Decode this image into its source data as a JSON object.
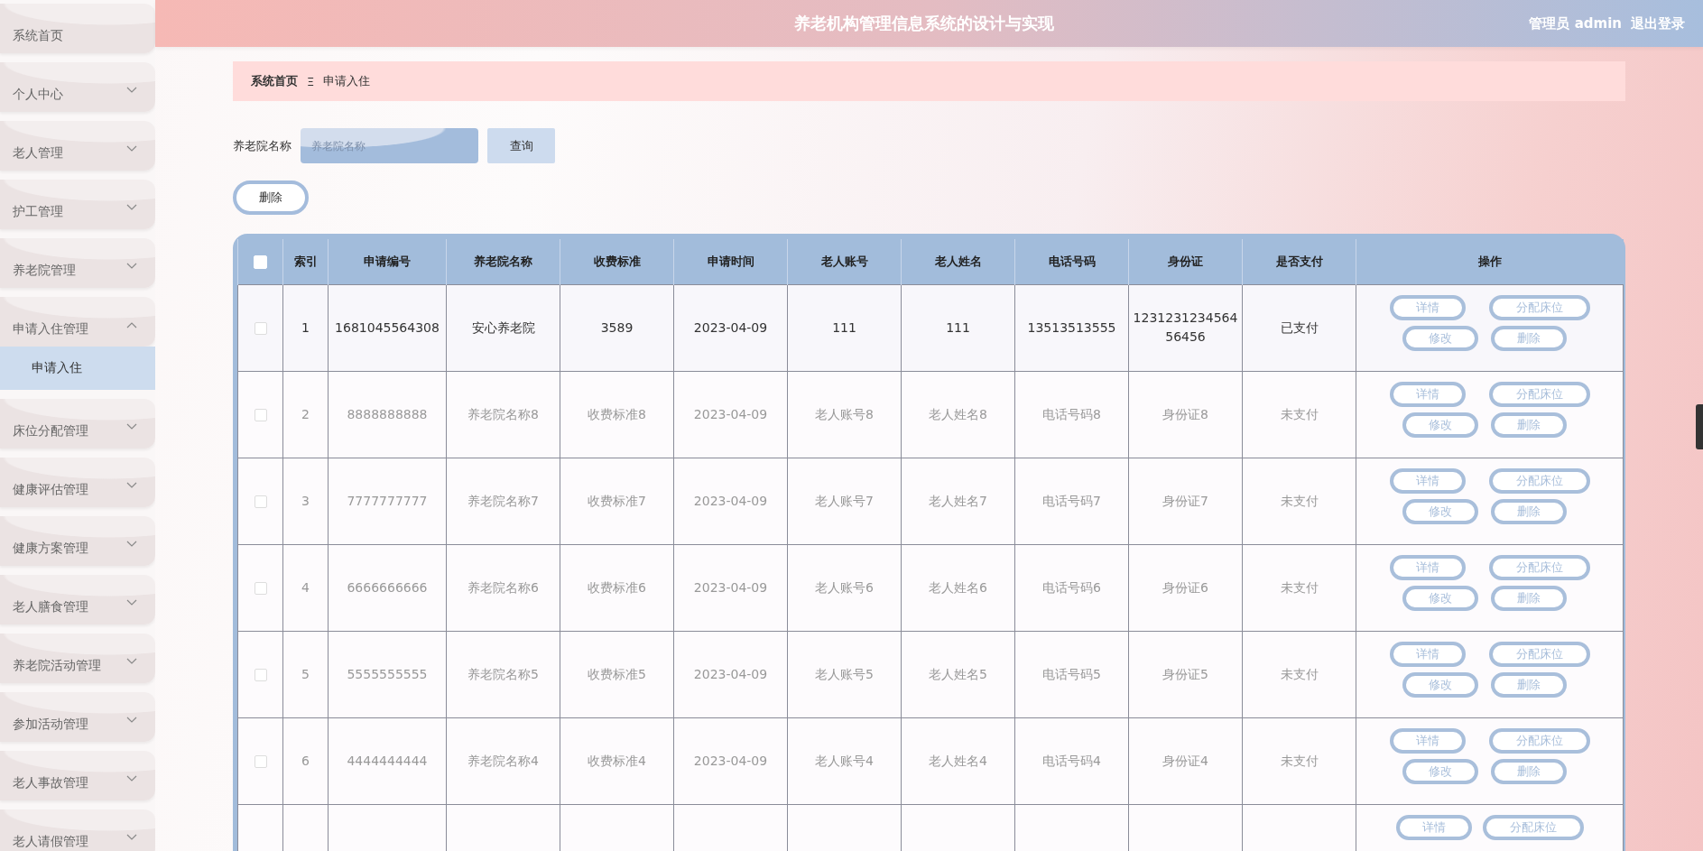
{
  "header": {
    "title": "养老机构管理信息系统的设计与实现",
    "user": "管理员 admin",
    "logout": "退出登录"
  },
  "sidebar": {
    "items": [
      {
        "label": "系统首页",
        "kind": "link"
      },
      {
        "label": "个人中心",
        "kind": "menu",
        "expanded": false
      },
      {
        "label": "老人管理",
        "kind": "menu",
        "expanded": false
      },
      {
        "label": "护工管理",
        "kind": "menu",
        "expanded": false
      },
      {
        "label": "养老院管理",
        "kind": "menu",
        "expanded": false
      },
      {
        "label": "申请入住管理",
        "kind": "menu",
        "expanded": true,
        "children": [
          {
            "label": "申请入住",
            "selected": true
          }
        ]
      },
      {
        "label": "床位分配管理",
        "kind": "menu",
        "expanded": false
      },
      {
        "label": "健康评估管理",
        "kind": "menu",
        "expanded": false
      },
      {
        "label": "健康方案管理",
        "kind": "menu",
        "expanded": false
      },
      {
        "label": "老人膳食管理",
        "kind": "menu",
        "expanded": false
      },
      {
        "label": "养老院活动管理",
        "kind": "menu",
        "expanded": false
      },
      {
        "label": "参加活动管理",
        "kind": "menu",
        "expanded": false
      },
      {
        "label": "老人事故管理",
        "kind": "menu",
        "expanded": false
      },
      {
        "label": "老人请假管理",
        "kind": "menu",
        "expanded": false
      }
    ]
  },
  "breadcrumb": {
    "items": [
      "系统首页",
      "申请入住"
    ],
    "separator": "Ξ"
  },
  "search": {
    "label": "养老院名称",
    "placeholder": "养老院名称",
    "button": "查询"
  },
  "delete_button": "删除",
  "table": {
    "all_checked": false,
    "columns": [
      "索引",
      "申请编号",
      "养老院名称",
      "收费标准",
      "申请时间",
      "老人账号",
      "老人姓名",
      "电话号码",
      "身份证",
      "是否支付",
      "操作"
    ],
    "rows": [
      {
        "highlighted": true,
        "checked": false,
        "cells": [
          "1",
          "1681045564308",
          "安心养老院",
          "3589",
          "2023-04-09",
          "111",
          "111",
          "13513513555",
          "1231231234564 56456",
          "已支付"
        ],
        "actions": [
          "详情",
          "分配床位",
          "修改",
          "删除"
        ]
      },
      {
        "highlighted": false,
        "checked": false,
        "cells": [
          "2",
          "8888888888",
          "养老院名称8",
          "收费标准8",
          "2023-04-09",
          "老人账号8",
          "老人姓名8",
          "电话号码8",
          "身份证8",
          "未支付"
        ],
        "actions": [
          "详情",
          "分配床位",
          "修改",
          "删除"
        ]
      },
      {
        "highlighted": false,
        "checked": false,
        "cells": [
          "3",
          "7777777777",
          "养老院名称7",
          "收费标准7",
          "2023-04-09",
          "老人账号7",
          "老人姓名7",
          "电话号码7",
          "身份证7",
          "未支付"
        ],
        "actions": [
          "详情",
          "分配床位",
          "修改",
          "删除"
        ]
      },
      {
        "highlighted": false,
        "checked": false,
        "cells": [
          "4",
          "6666666666",
          "养老院名称6",
          "收费标准6",
          "2023-04-09",
          "老人账号6",
          "老人姓名6",
          "电话号码6",
          "身份证6",
          "未支付"
        ],
        "actions": [
          "详情",
          "分配床位",
          "修改",
          "删除"
        ]
      },
      {
        "highlighted": false,
        "checked": false,
        "cells": [
          "5",
          "5555555555",
          "养老院名称5",
          "收费标准5",
          "2023-04-09",
          "老人账号5",
          "老人姓名5",
          "电话号码5",
          "身份证5",
          "未支付"
        ],
        "actions": [
          "详情",
          "分配床位",
          "修改",
          "删除"
        ]
      },
      {
        "highlighted": false,
        "checked": false,
        "cells": [
          "6",
          "4444444444",
          "养老院名称4",
          "收费标准4",
          "2023-04-09",
          "老人账号4",
          "老人姓名4",
          "电话号码4",
          "身份证4",
          "未支付"
        ],
        "actions": [
          "详情",
          "分配床位",
          "修改",
          "删除"
        ]
      },
      {
        "actions": [
          "详情",
          "分配床位"
        ]
      }
    ]
  }
}
